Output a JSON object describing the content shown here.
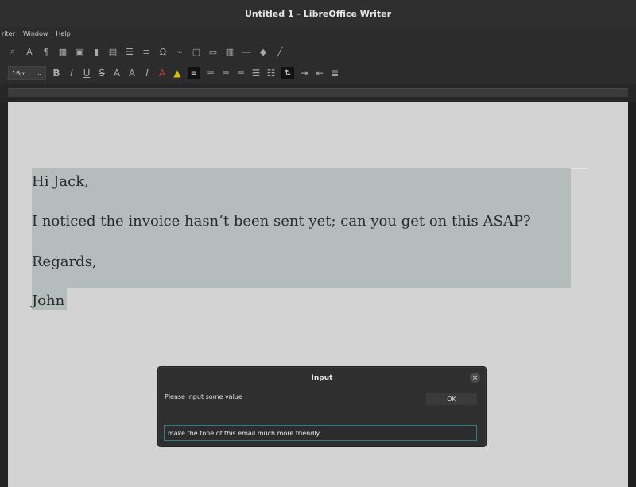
{
  "window": {
    "title": "Untitled 1 - LibreOffice Writer"
  },
  "menubar": {
    "items": [
      "riter",
      "Window",
      "Help"
    ]
  },
  "toolbar2": {
    "font_size": "16pt"
  },
  "document": {
    "lines": [
      "Hi Jack,",
      "I noticed the invoice hasn’t been sent yet; can you get on this ASAP?",
      "Regards,",
      "John"
    ]
  },
  "dialog": {
    "title": "Input",
    "prompt": "Please input some value",
    "ok_label": "OK",
    "input_value": "make the tone of this email much more friendly"
  },
  "colors": {
    "selection": "#b5bcbc",
    "input_border": "#2d7f7f"
  }
}
